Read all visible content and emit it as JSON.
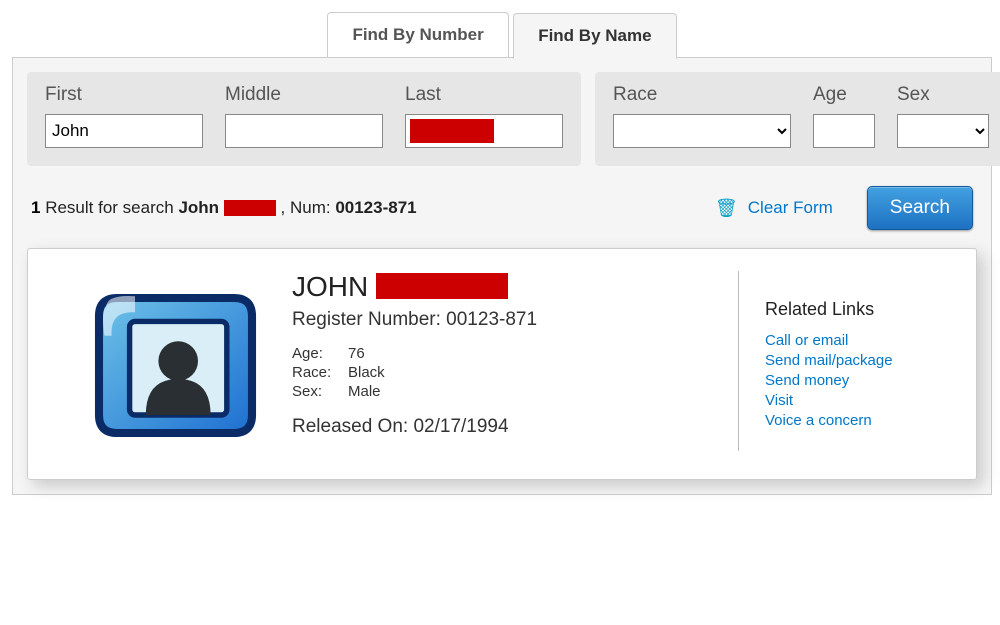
{
  "tabs": {
    "by_number": "Find By Number",
    "by_name": "Find By Name"
  },
  "form": {
    "first": {
      "label": "First",
      "value": "John"
    },
    "middle": {
      "label": "Middle",
      "value": ""
    },
    "last": {
      "label": "Last",
      "value": ""
    },
    "race": {
      "label": "Race",
      "value": ""
    },
    "age": {
      "label": "Age",
      "value": ""
    },
    "sex": {
      "label": "Sex",
      "value": ""
    }
  },
  "result_line": {
    "count": "1",
    "prefix": "Result for search",
    "name": "John",
    "num_label": ", Num:",
    "regnum": "00123-871"
  },
  "actions": {
    "clear": "Clear Form",
    "search": "Search"
  },
  "card": {
    "first_name": "JOHN",
    "reg_label": "Register Number: ",
    "reg_num": "00123-871",
    "age_label": "Age:",
    "age": "76",
    "race_label": "Race:",
    "race": "Black",
    "sex_label": "Sex:",
    "sex": "Male",
    "released_label": "Released On: ",
    "released": "02/17/1994"
  },
  "links": {
    "heading": "Related Links",
    "items": [
      "Call or email",
      "Send mail/package",
      "Send money",
      "Visit",
      "Voice a concern"
    ]
  }
}
